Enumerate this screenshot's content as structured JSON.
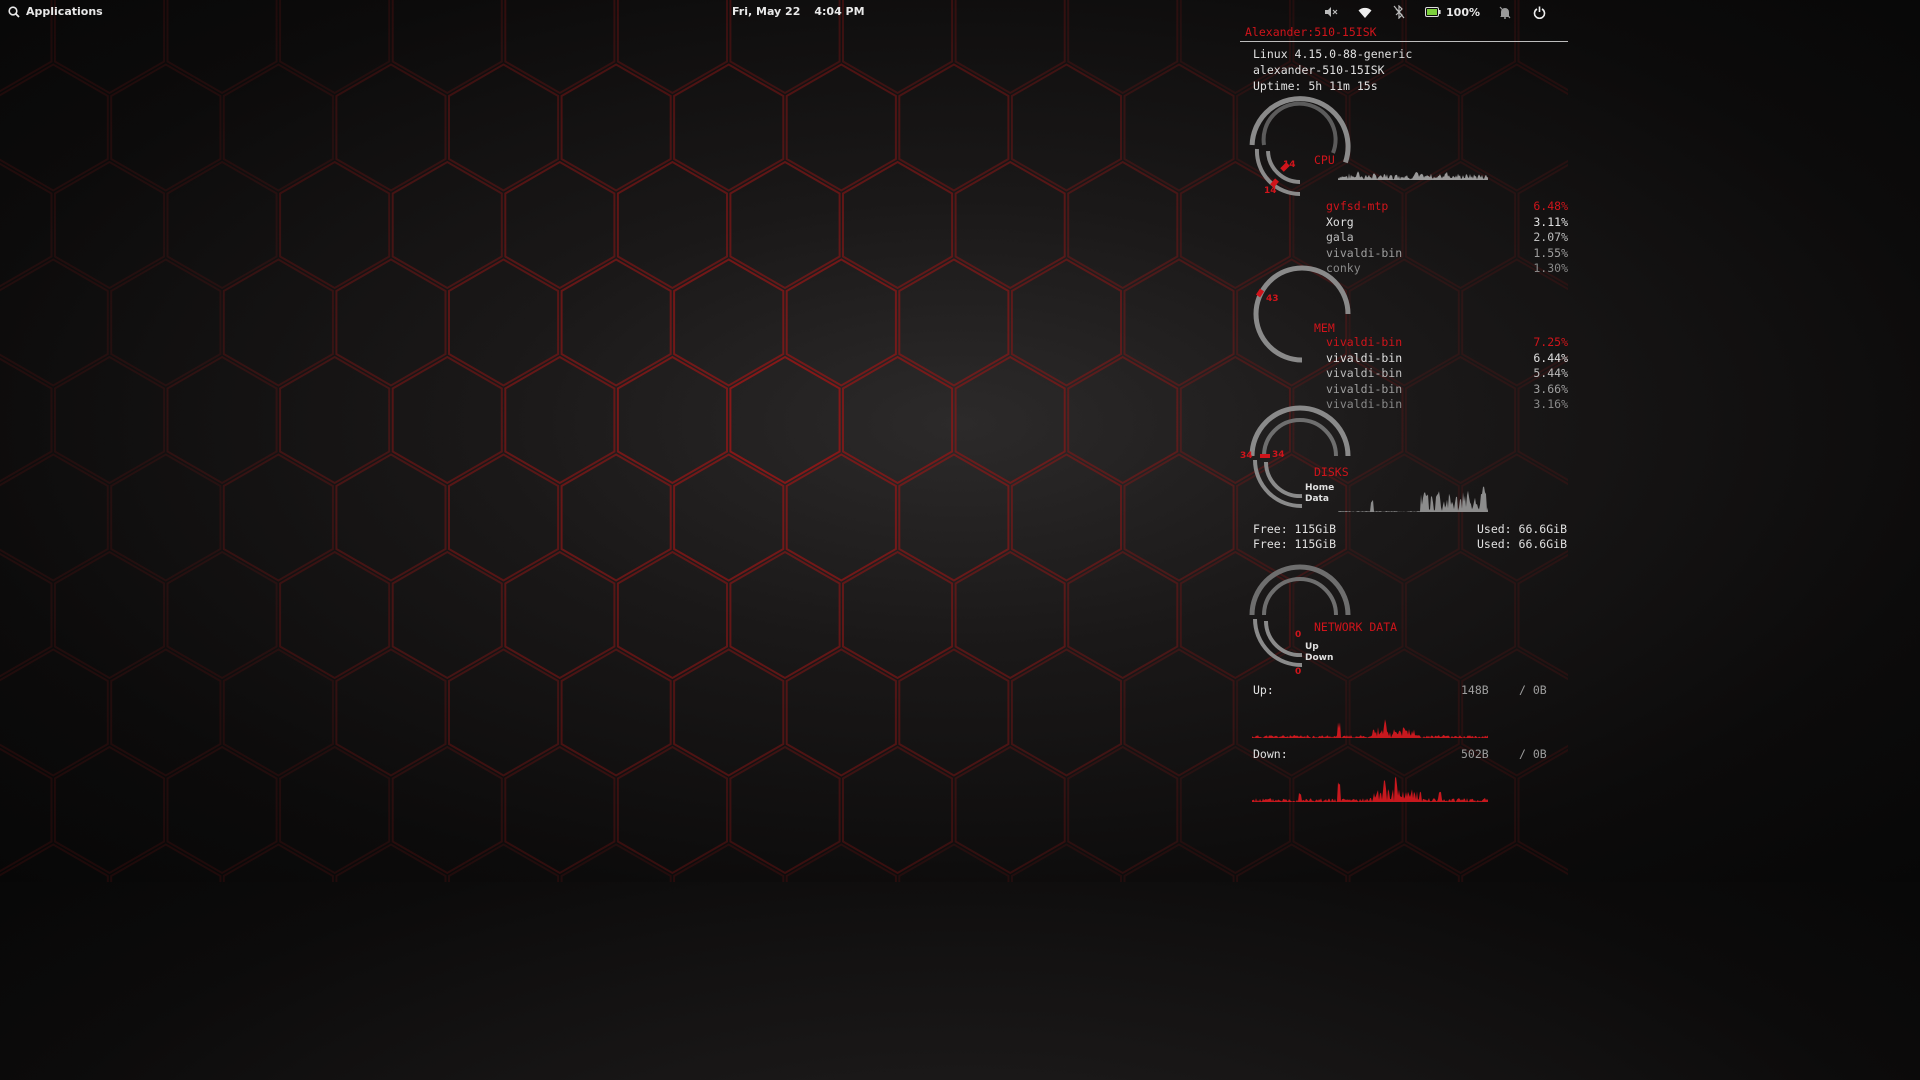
{
  "panel": {
    "applications_label": "Applications",
    "date": "Fri, May 22",
    "time": "4:04 PM",
    "battery_percent": "100%",
    "tray_icons": [
      "volume-muted-icon",
      "wifi-icon",
      "bluetooth-disabled-icon",
      "battery-icon",
      "notifications-off-icon",
      "power-icon"
    ]
  },
  "conky": {
    "hostname_header": "Alexander:510-15ISK",
    "kernel": "Linux 4.15.0-88-generic",
    "hostname": "alexander-510-15ISK",
    "uptime": "Uptime: 5h 11m 15s",
    "cpu": {
      "label": "CPU",
      "gauge_outer": "14",
      "gauge_inner": "14",
      "processes": [
        {
          "name": "gvfsd-mtp",
          "value": "6.48%"
        },
        {
          "name": "Xorg",
          "value": "3.11%"
        },
        {
          "name": "gala",
          "value": "2.07%"
        },
        {
          "name": "vivaldi-bin",
          "value": "1.55%"
        },
        {
          "name": "conky",
          "value": "1.30%"
        }
      ]
    },
    "mem": {
      "label": "MEM",
      "gauge": "43",
      "processes": [
        {
          "name": "vivaldi-bin",
          "value": "7.25%"
        },
        {
          "name": "vivaldi-bin",
          "value": "6.44%"
        },
        {
          "name": "vivaldi-bin",
          "value": "5.44%"
        },
        {
          "name": "vivaldi-bin",
          "value": "3.66%"
        },
        {
          "name": "vivaldi-bin",
          "value": "3.16%"
        }
      ]
    },
    "disks": {
      "label": "DISKS",
      "gauge_left": "34",
      "gauge_right": "34",
      "home_label": "Home",
      "data_label": "Data",
      "rows": [
        {
          "free": "Free: 115GiB",
          "used": "Used: 66.6GiB"
        },
        {
          "free": "Free: 115GiB",
          "used": "Used: 66.6GiB"
        }
      ]
    },
    "network": {
      "label": "NETWORK DATA",
      "gauge_up": "0",
      "gauge_down": "0",
      "up_label": "Up",
      "down_label": "Down",
      "up_row": {
        "label": "Up:",
        "rate": "148B",
        "total": "/ 0B"
      },
      "down_row": {
        "label": "Down:",
        "rate": "502B",
        "total": "/ 0B"
      }
    },
    "colors": {
      "accent": "#d0141b",
      "arc": "#8a8a8a",
      "graph_grey": "#9a9a9a"
    }
  }
}
